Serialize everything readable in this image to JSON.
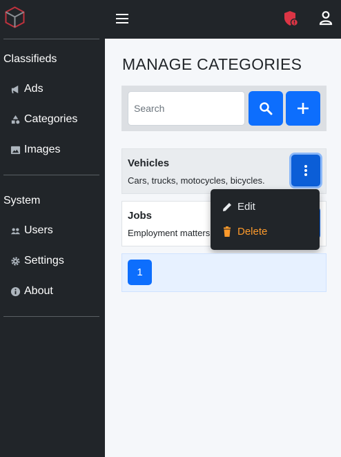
{
  "sidebar": {
    "sections": [
      {
        "title": "Classifieds",
        "items": [
          {
            "label": "Ads",
            "icon": "megaphone-icon"
          },
          {
            "label": "Categories",
            "icon": "shapes-icon"
          },
          {
            "label": "Images",
            "icon": "image-icon"
          }
        ]
      },
      {
        "title": "System",
        "items": [
          {
            "label": "Users",
            "icon": "users-icon"
          },
          {
            "label": "Settings",
            "icon": "gear-icon"
          },
          {
            "label": "About",
            "icon": "info-icon"
          }
        ]
      }
    ]
  },
  "topbar": {
    "menu_icon": "hamburger-icon",
    "alert_icon": "shield-alert-icon",
    "account_icon": "user-icon"
  },
  "page": {
    "title": "MANAGE CATEGORIES"
  },
  "search": {
    "placeholder": "Search",
    "value": ""
  },
  "categories": [
    {
      "title": "Vehicles",
      "description": "Cars, trucks, motocycles, bicycles."
    },
    {
      "title": "Jobs",
      "description": "Employment matters"
    }
  ],
  "dropdown": {
    "edit_label": "Edit",
    "delete_label": "Delete"
  },
  "pagination": {
    "current_page": "1"
  },
  "colors": {
    "sidebar_bg": "#212529",
    "primary": "#0d6efd",
    "delete": "#fd9a2b",
    "alert_red": "#dc3545"
  }
}
